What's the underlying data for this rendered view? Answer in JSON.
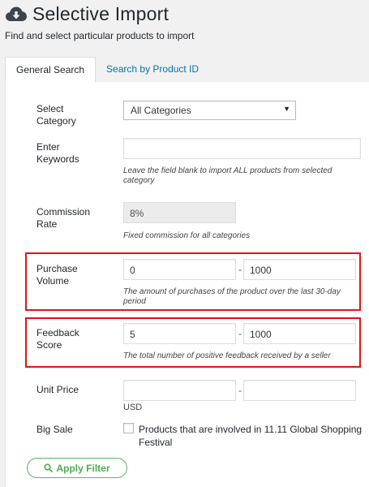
{
  "header": {
    "title": "Selective Import",
    "subtitle": "Find and select particular products to import",
    "icon": "cloud-download-icon"
  },
  "tabs": [
    {
      "label": "General Search",
      "active": true
    },
    {
      "label": "Search by Product ID",
      "active": false
    }
  ],
  "form": {
    "category": {
      "label_line1": "Select",
      "label_line2": "Category",
      "value": "All Categories"
    },
    "keywords": {
      "label_line1": "Enter",
      "label_line2": "Keywords",
      "value": "",
      "hint_line1": "Leave the field blank to import ALL products from selected",
      "hint_line2": "category"
    },
    "commission": {
      "label_line1": "Commission",
      "label_line2": "Rate",
      "value": "8%",
      "hint": "Fixed commission for all categories"
    },
    "purchase_volume": {
      "label_line1": "Purchase",
      "label_line2": "Volume",
      "min": "0",
      "max": "1000",
      "separator": "-",
      "hint_line1": "The amount of purchases of the product over the last 30-day",
      "hint_line2": "period"
    },
    "feedback_score": {
      "label_line1": "Feedback",
      "label_line2": "Score",
      "min": "5",
      "max": "1000",
      "separator": "-",
      "hint": "The total number of positive feedback received by a seller"
    },
    "unit_price": {
      "label": "Unit Price",
      "min": "",
      "max": "",
      "separator": "-",
      "currency": "USD"
    },
    "big_sale": {
      "label": "Big Sale",
      "checked": false,
      "option_line1": "Products that are involved in 11.11 Global Shopping",
      "option_line2": "Festival"
    }
  },
  "apply_button": {
    "label": "Apply Filter",
    "icon": "search-icon"
  },
  "colors": {
    "highlight": "#e1131d",
    "link": "#0073aa",
    "button": "#5cb85c"
  }
}
